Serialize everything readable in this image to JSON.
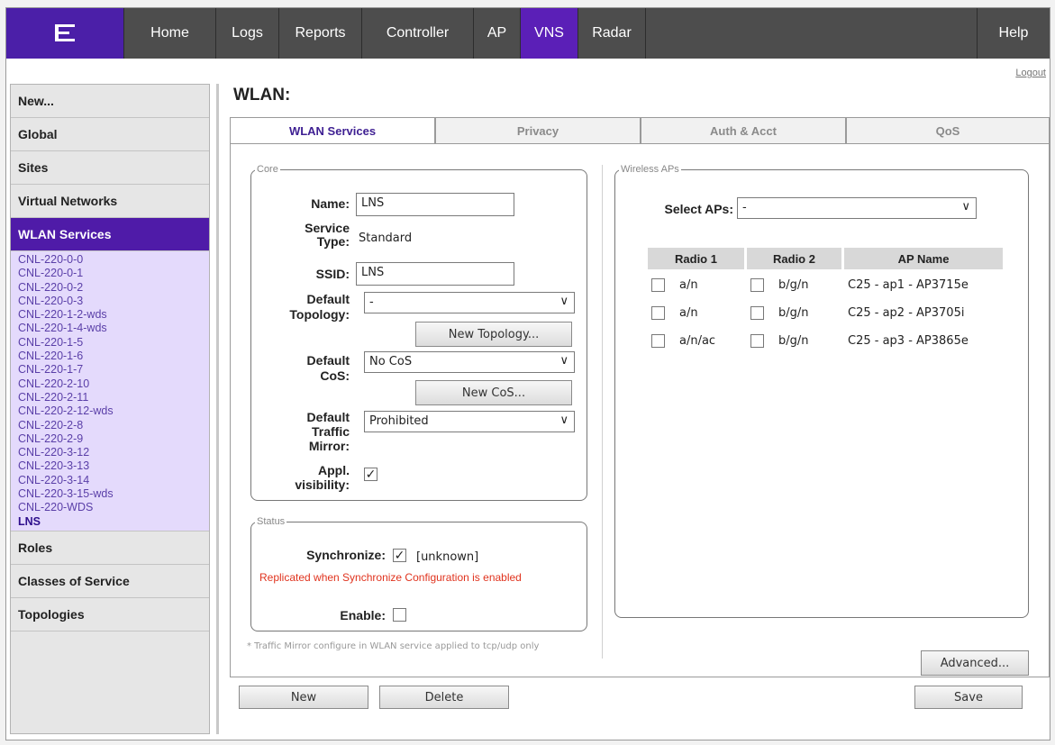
{
  "nav": {
    "logo_icon": "extreme-logo-icon",
    "items": [
      "Home",
      "Logs",
      "Reports",
      "Controller",
      "AP",
      "VNS",
      "Radar"
    ],
    "help": "Help",
    "logout": "Logout"
  },
  "sidebar": {
    "items": [
      "New...",
      "Global",
      "Sites",
      "Virtual Networks",
      "WLAN Services",
      "Roles",
      "Classes of Service",
      "Topologies"
    ],
    "wlan_list": [
      "CNL-220-0-0",
      "CNL-220-0-1",
      "CNL-220-0-2",
      "CNL-220-0-3",
      "CNL-220-1-2-wds",
      "CNL-220-1-4-wds",
      "CNL-220-1-5",
      "CNL-220-1-6",
      "CNL-220-1-7",
      "CNL-220-2-10",
      "CNL-220-2-11",
      "CNL-220-2-12-wds",
      "CNL-220-2-8",
      "CNL-220-2-9",
      "CNL-220-3-12",
      "CNL-220-3-13",
      "CNL-220-3-14",
      "CNL-220-3-15-wds",
      "CNL-220-WDS",
      "LNS"
    ]
  },
  "page": {
    "title": "WLAN:"
  },
  "tabs": [
    "WLAN Services",
    "Privacy",
    "Auth & Acct",
    "QoS"
  ],
  "core": {
    "legend": "Core",
    "name_label": "Name:",
    "name_value": "LNS",
    "service_type_label_1": "Service",
    "service_type_label_2": "Type:",
    "service_type_value": "Standard",
    "ssid_label": "SSID:",
    "ssid_value": "LNS",
    "topology_label_1": "Default",
    "topology_label_2": "Topology:",
    "topology_value": "-",
    "new_topology": "New Topology...",
    "cos_label_1": "Default",
    "cos_label_2": "CoS:",
    "cos_value": "No CoS",
    "new_cos": "New CoS...",
    "mirror_label_1": "Default",
    "mirror_label_2": "Traffic",
    "mirror_label_3": "Mirror:",
    "mirror_value": "Prohibited",
    "appl_label_1": "Appl.",
    "appl_label_2": "visibility:",
    "appl_checked": "✓"
  },
  "status": {
    "legend": "Status",
    "sync_label": "Synchronize:",
    "sync_checked": "✓",
    "sync_state": "[unknown]",
    "replicated_note": "Replicated when Synchronize Configuration is enabled",
    "enable_label": "Enable:"
  },
  "wireless": {
    "legend": "Wireless APs",
    "select_label": "Select APs:",
    "select_value": "-",
    "headers": [
      "Radio 1",
      "Radio 2",
      "AP Name"
    ],
    "rows": [
      {
        "radio1": "a/n",
        "radio2": "b/g/n",
        "ap": "C25 - ap1 - AP3715e"
      },
      {
        "radio1": "a/n",
        "radio2": "b/g/n",
        "ap": "C25 - ap2 - AP3705i"
      },
      {
        "radio1": "a/n/ac",
        "radio2": "b/g/n",
        "ap": "C25 - ap3 - AP3865e"
      }
    ]
  },
  "footer": {
    "note": "* Traffic Mirror configure in WLAN service applied to tcp/udp only",
    "advanced": "Advanced...",
    "new": "New",
    "delete": "Delete",
    "save": "Save"
  }
}
